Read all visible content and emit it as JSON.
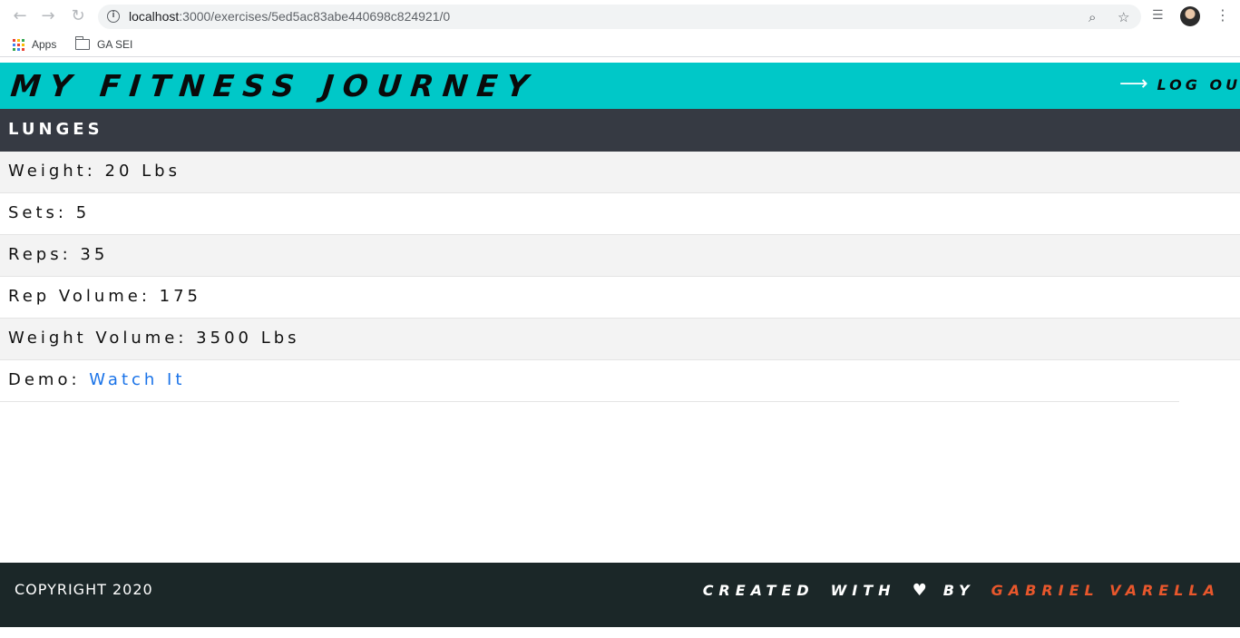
{
  "browser": {
    "url_host": "localhost",
    "url_path": ":3000/exercises/5ed5ac83abe440698c824921/0",
    "bookmarks": [
      "Apps",
      "GA SEI"
    ]
  },
  "app": {
    "title": "MY FITNESS JOURNEY",
    "logout_label": "LOG OUT"
  },
  "exercise": {
    "name": "LUNGES",
    "details": [
      {
        "text": "Weight: 20 Lbs"
      },
      {
        "text": "Sets: 5"
      },
      {
        "text": "Reps: 35"
      },
      {
        "text": "Rep Volume: 175"
      },
      {
        "text": "Weight Volume: 3500 Lbs"
      }
    ],
    "demo_label": "Demo:",
    "demo_link": "Watch It"
  },
  "footer": {
    "copyright": "COPYRIGHT 2020",
    "credit_created": "CREATED",
    "credit_with": "WITH",
    "credit_by": "BY",
    "author": "GABRIEL VARELLA"
  },
  "colors": {
    "header": "#00c8c8",
    "exercise_bar": "#363a43",
    "footer": "#1b2728",
    "link": "#1a73e8",
    "author": "#e8572c"
  }
}
